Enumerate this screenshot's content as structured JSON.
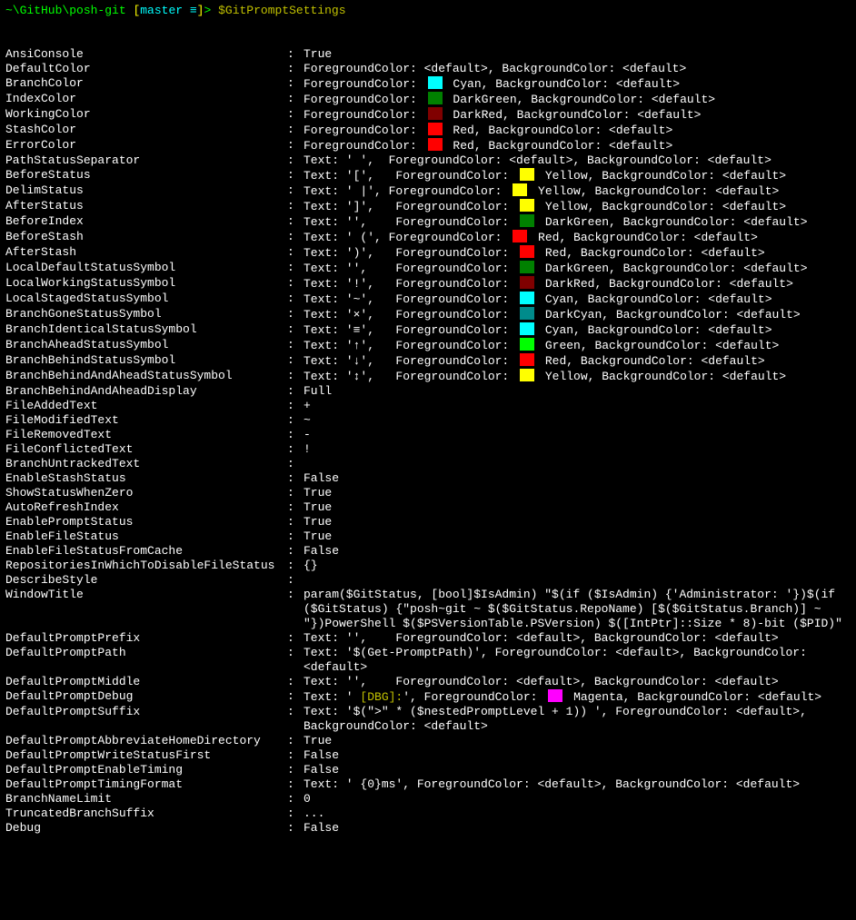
{
  "prompt": {
    "path": "~\\GitHub\\posh-git ",
    "branch_open": "[",
    "branch": "master ≡",
    "branch_close": "]",
    "gt": "> ",
    "cmd": "$GitPromptSettings"
  },
  "colors": {
    "Cyan": "#00ffff",
    "DarkGreen": "#008000",
    "DarkRed": "#800000",
    "Red": "#ff0000",
    "Yellow": "#ffff00",
    "Green": "#00ff00",
    "DarkCyan": "#008b8b",
    "Magenta": "#ff00ff"
  },
  "rows": [
    {
      "k": "AnsiConsole",
      "v": "True"
    },
    {
      "k": "DefaultColor",
      "v": "ForegroundColor: <default>, BackgroundColor: <default>"
    },
    {
      "k": "BranchColor",
      "fg": "Cyan"
    },
    {
      "k": "IndexColor",
      "fg": "DarkGreen"
    },
    {
      "k": "WorkingColor",
      "fg": "DarkRed"
    },
    {
      "k": "StashColor",
      "fg": "Red"
    },
    {
      "k": "ErrorColor",
      "fg": "Red"
    },
    {
      "k": "PathStatusSeparator",
      "text": "' '",
      "fgText": "<default>"
    },
    {
      "k": "BeforeStatus",
      "text": "'['",
      "fg": "Yellow",
      "pad": true
    },
    {
      "k": "DelimStatus",
      "text": "' |'",
      "fg": "Yellow"
    },
    {
      "k": "AfterStatus",
      "text": "']'",
      "fg": "Yellow",
      "pad": true
    },
    {
      "k": "BeforeIndex",
      "text": "''",
      "fg": "DarkGreen",
      "pad": true
    },
    {
      "k": "BeforeStash",
      "text": "' ('",
      "fg": "Red"
    },
    {
      "k": "AfterStash",
      "text": "')'",
      "fg": "Red",
      "pad": true
    },
    {
      "k": "LocalDefaultStatusSymbol",
      "text": "''",
      "fg": "DarkGreen",
      "pad": true
    },
    {
      "k": "LocalWorkingStatusSymbol",
      "text": "'!'",
      "fg": "DarkRed",
      "pad": true
    },
    {
      "k": "LocalStagedStatusSymbol",
      "text": "'~'",
      "fg": "Cyan",
      "pad": true
    },
    {
      "k": "BranchGoneStatusSymbol",
      "text": "'×'",
      "fg": "DarkCyan",
      "pad": true
    },
    {
      "k": "BranchIdenticalStatusSymbol",
      "text": "'≡'",
      "fg": "Cyan",
      "pad": true
    },
    {
      "k": "BranchAheadStatusSymbol",
      "text": "'↑'",
      "fg": "Green",
      "pad": true
    },
    {
      "k": "BranchBehindStatusSymbol",
      "text": "'↓'",
      "fg": "Red",
      "pad": true
    },
    {
      "k": "BranchBehindAndAheadStatusSymbol",
      "text": "'↕'",
      "fg": "Yellow",
      "pad": true
    },
    {
      "k": "BranchBehindAndAheadDisplay",
      "v": "Full"
    },
    {
      "k": "FileAddedText",
      "v": "+"
    },
    {
      "k": "FileModifiedText",
      "v": "~"
    },
    {
      "k": "FileRemovedText",
      "v": "-"
    },
    {
      "k": "FileConflictedText",
      "v": "!"
    },
    {
      "k": "BranchUntrackedText",
      "v": ""
    },
    {
      "k": "EnableStashStatus",
      "v": "False"
    },
    {
      "k": "ShowStatusWhenZero",
      "v": "True"
    },
    {
      "k": "AutoRefreshIndex",
      "v": "True"
    },
    {
      "k": "EnablePromptStatus",
      "v": "True"
    },
    {
      "k": "EnableFileStatus",
      "v": "True"
    },
    {
      "k": "EnableFileStatusFromCache",
      "v": "False"
    },
    {
      "k": "RepositoriesInWhichToDisableFileStatus",
      "v": "{}"
    },
    {
      "k": "DescribeStyle",
      "v": ""
    },
    {
      "k": "WindowTitle",
      "v": "param($GitStatus, [bool]$IsAdmin) \"$(if ($IsAdmin) {'Administrator: '})$(if ($GitStatus) {\"posh~git ~ $($GitStatus.RepoName) [$($GitStatus.Branch)] ~ \"})PowerShell $($PSVersionTable.PSVersion) $([IntPtr]::Size * 8)-bit ($PID)\""
    },
    {
      "k": "DefaultPromptPrefix",
      "text": "''",
      "fgText": "<default>",
      "pad": true
    },
    {
      "k": "DefaultPromptPath",
      "v": "Text: '$(Get-PromptPath)', ForegroundColor: <default>, BackgroundColor: <default>"
    },
    {
      "k": "DefaultPromptMiddle",
      "text": "''",
      "fgText": "<default>",
      "pad": true
    },
    {
      "k": "DefaultPromptDebug",
      "dbg": true
    },
    {
      "k": "DefaultPromptSuffix",
      "v": "Text: '$(\">\" * ($nestedPromptLevel + 1)) ', ForegroundColor: <default>, BackgroundColor: <default>"
    },
    {
      "k": "DefaultPromptAbbreviateHomeDirectory",
      "v": "True"
    },
    {
      "k": "DefaultPromptWriteStatusFirst",
      "v": "False"
    },
    {
      "k": "DefaultPromptEnableTiming",
      "v": "False"
    },
    {
      "k": "DefaultPromptTimingFormat",
      "v": "Text: ' {0}ms', ForegroundColor: <default>, BackgroundColor: <default>"
    },
    {
      "k": "BranchNameLimit",
      "v": "0"
    },
    {
      "k": "TruncatedBranchSuffix",
      "v": "..."
    },
    {
      "k": "Debug",
      "v": "False"
    }
  ],
  "labels": {
    "fgPrefix": "ForegroundColor: ",
    "bgDefault": ", BackgroundColor: <default>",
    "textPrefix": "Text: ",
    "dbgText": "Text: ' ",
    "dbgLabel": "[DBG]:",
    "dbgAfter": "', ForegroundColor: ",
    "dbgColor": " Magenta, BackgroundColor: <default>"
  }
}
